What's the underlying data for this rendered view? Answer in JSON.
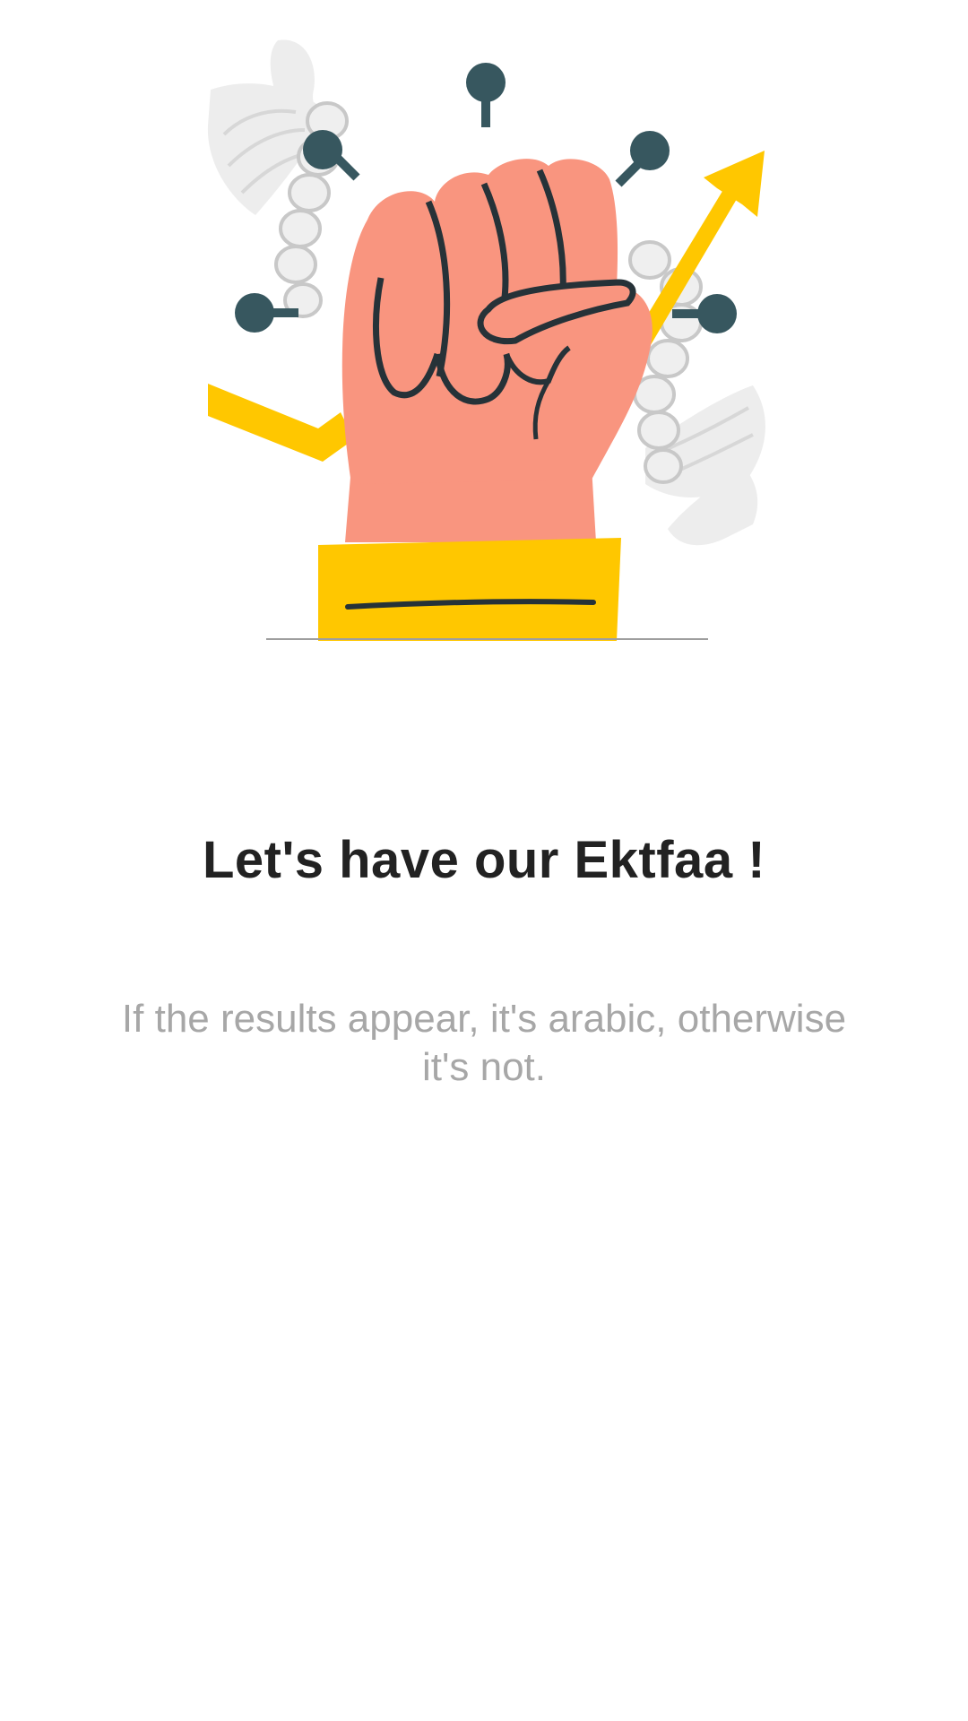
{
  "onboarding": {
    "illustration": {
      "icon": "raised-fist-illustration",
      "colors": {
        "skin": "#F9957F",
        "sleeve": "#FFC700",
        "outline": "#263238",
        "pin": "#37575F",
        "trend_arrow": "#FFC700",
        "rope": "#E6E6E6"
      }
    },
    "title": "Let's have our Ektfaa !",
    "subtitle": "If the results appear, it's arabic, otherwise it's not."
  },
  "colors": {
    "background": "#FFFFFF",
    "title_text": "#222222",
    "subtitle_text": "#A7A7A7"
  }
}
